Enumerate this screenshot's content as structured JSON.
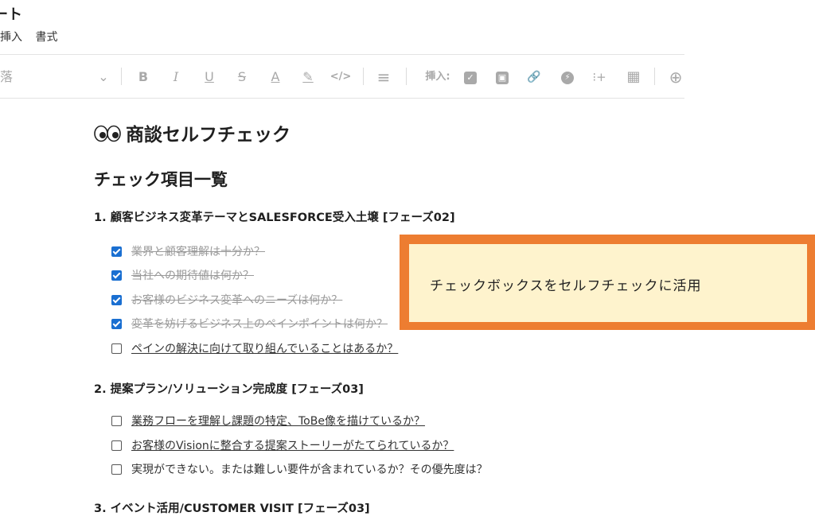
{
  "header": {
    "doc_title": "ート",
    "menu": [
      "挿入",
      "書式"
    ]
  },
  "toolbar": {
    "paragraph_label": "落",
    "chevron": "⌄",
    "bold": "B",
    "italic": "I",
    "underline": "U",
    "strike": "S",
    "text_color": "A",
    "highlight": "✎",
    "code": "</>",
    "align": "≡",
    "insert_label": "挿入:",
    "checklist_icon": "✓",
    "image_icon": "▣",
    "link_icon": "🔗",
    "bolt_icon": "⚡",
    "divider_icon": "⁝+",
    "table_icon": "▦",
    "more_icon": "⊕"
  },
  "page": {
    "title": "商談セルフチェック",
    "section_heading": "チェック項目一覧",
    "groups": [
      {
        "heading": "1. 顧客ビジネス変革テーマとSALESFORCE受入土壌 [フェーズ02]",
        "items": [
          {
            "text": "業界と顧客理解は十分か？",
            "checked": true
          },
          {
            "text": "当社への期待値は何か？",
            "checked": true
          },
          {
            "text": "お客様のビジネス変革へのニーズは何か？",
            "checked": true
          },
          {
            "text": "変革を妨げるビジネス上のペインポイントは何か？",
            "checked": true
          },
          {
            "text": "ペインの解決に向けて取り組んでいることはあるか？",
            "checked": false
          }
        ]
      },
      {
        "heading": "2. 提案プラン/ソリューション完成度 [フェーズ03]",
        "items": [
          {
            "text": "業務フローを理解し課題の特定、ToBe像を描けているか？",
            "checked": false
          },
          {
            "text": "お客様のVisionに整合する提案ストーリーがたてられているか？",
            "checked": false
          },
          {
            "text": "実現ができない。または難しい要件が含まれているか？その優先度は？",
            "checked": false
          }
        ]
      },
      {
        "heading": "3. イベント活用/CUSTOMER VISIT [フェーズ03]"
      }
    ]
  },
  "callout": {
    "text": "チェックボックスをセルフチェックに活用"
  },
  "colors": {
    "checkbox_checked": "#1a6fd1",
    "callout_border": "#ed7d31",
    "callout_fill": "#fef3cd"
  }
}
